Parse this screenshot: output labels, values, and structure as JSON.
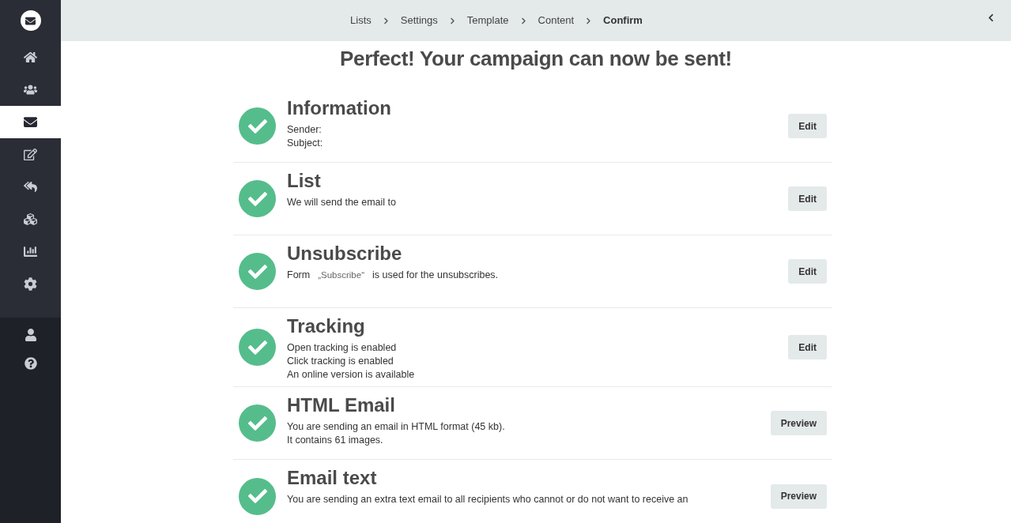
{
  "sidebar": {
    "items": [
      {
        "selected": false
      },
      {
        "selected": false
      },
      {
        "selected": true
      },
      {
        "selected": false
      },
      {
        "selected": false
      },
      {
        "selected": false
      },
      {
        "selected": false
      },
      {
        "selected": false
      }
    ]
  },
  "breadcrumb": [
    {
      "label": "Lists",
      "selected": false
    },
    {
      "label": "Settings",
      "selected": false
    },
    {
      "label": "Template",
      "selected": false
    },
    {
      "label": "Content",
      "selected": false
    },
    {
      "label": "Confirm",
      "selected": true
    }
  ],
  "heading": "Perfect! Your campaign can now be sent!",
  "sections": [
    {
      "title": "Information",
      "lines": [
        [
          {
            "text": "Sender:",
            "kind": "plain"
          }
        ],
        [
          {
            "text": "Subject:",
            "kind": "plain"
          }
        ]
      ],
      "button": "Edit"
    },
    {
      "title": "List",
      "lines": [
        [
          {
            "text": "We will send the email to",
            "kind": "plain"
          }
        ]
      ],
      "button": "Edit"
    },
    {
      "title": "Unsubscribe",
      "lines": [
        [
          {
            "text": "Form",
            "kind": "plain"
          },
          {
            "text": "„Subscribe“",
            "kind": "quote"
          },
          {
            "text": "is used for the unsubscribes.",
            "kind": "plain"
          }
        ]
      ],
      "button": "Edit"
    },
    {
      "title": "Tracking",
      "lines": [
        [
          {
            "text": "Open tracking is enabled",
            "kind": "plain"
          }
        ],
        [
          {
            "text": "Click tracking is enabled",
            "kind": "plain"
          }
        ],
        [
          {
            "text": "An online version is available",
            "kind": "plain"
          }
        ]
      ],
      "button": "Edit"
    },
    {
      "title": "HTML Email",
      "lines": [
        [
          {
            "text": "You are sending an email in HTML format (45 kb).",
            "kind": "plain"
          }
        ],
        [
          {
            "text": "It contains 61 images.",
            "kind": "plain"
          }
        ]
      ],
      "button": "Preview"
    },
    {
      "title": "Email text",
      "lines": [
        [
          {
            "text": "You are sending an extra text email to all recipients who cannot or do not want to receive an",
            "kind": "plain"
          }
        ]
      ],
      "button": "Preview"
    }
  ]
}
